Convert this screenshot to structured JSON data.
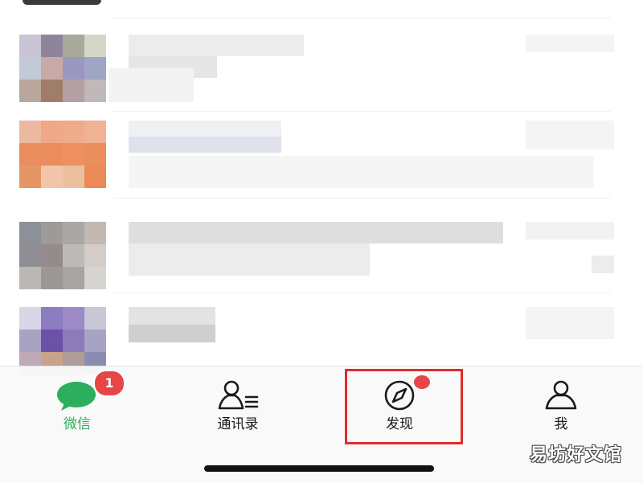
{
  "top_thumb": {
    "caption": ""
  },
  "tabbar": {
    "tabs": [
      {
        "label": "微信",
        "icon": "chat-bubble-icon",
        "active": true,
        "badge": "1"
      },
      {
        "label": "通讯录",
        "icon": "contacts-icon",
        "active": false
      },
      {
        "label": "发现",
        "icon": "compass-icon",
        "active": false,
        "dot": true
      },
      {
        "label": "我",
        "icon": "person-icon",
        "active": false
      }
    ]
  },
  "colors": {
    "active_green": "#2dae5e",
    "badge_red": "#e64646",
    "highlight_red": "#e22a2a",
    "icon_dark": "#1a1a1a"
  },
  "annotation": {
    "highlighted_tab": "发现"
  },
  "watermark": "易坊好文馆"
}
